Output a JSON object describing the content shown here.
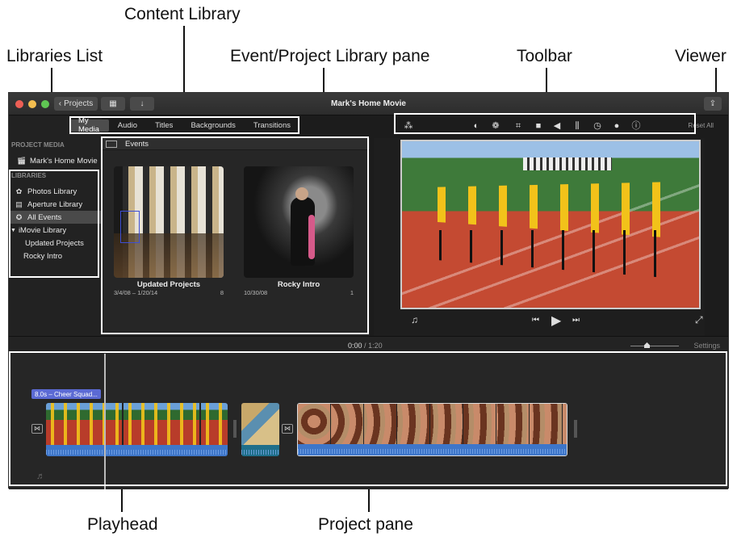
{
  "callouts": {
    "content_library": "Content Library",
    "libraries_list": "Libraries List",
    "event_project_pane": "Event/Project Library pane",
    "toolbar": "Toolbar",
    "viewer": "Viewer",
    "playhead": "Playhead",
    "project_pane": "Project pane"
  },
  "window": {
    "title": "Mark's Home Movie",
    "back_button": "Projects"
  },
  "media_tabs": [
    "My Media",
    "Audio",
    "Titles",
    "Backgrounds",
    "Transitions"
  ],
  "sidebar": {
    "project_media_heading": "PROJECT MEDIA",
    "project_item": "Mark's Home Movie",
    "libraries_heading": "LIBRARIES",
    "items": [
      "Photos Library",
      "Aperture Library",
      "All Events"
    ],
    "imovie_library": "iMovie Library",
    "sub_items": [
      "Updated Projects",
      "Rocky Intro"
    ]
  },
  "browser": {
    "header": "Events",
    "events": [
      {
        "title": "Updated Projects",
        "dates": "3/4/08 – 1/20/14",
        "count": "8"
      },
      {
        "title": "Rocky Intro",
        "dates": "10/30/08",
        "count": "1"
      }
    ]
  },
  "toolbar": {
    "reset_label": "Reset All",
    "icons": [
      "magic-wand-icon",
      "color-balance-icon",
      "color-palette-icon",
      "crop-icon",
      "camera-stabilization-icon",
      "volume-icon",
      "equalizer-icon",
      "speed-icon",
      "clip-filter-icon",
      "info-icon"
    ]
  },
  "status": {
    "current_time": "0:00",
    "separator": "/",
    "total_time": "1:20",
    "settings_label": "Settings"
  },
  "timeline": {
    "clip_label": "8.0s – Cheer Squad..."
  }
}
